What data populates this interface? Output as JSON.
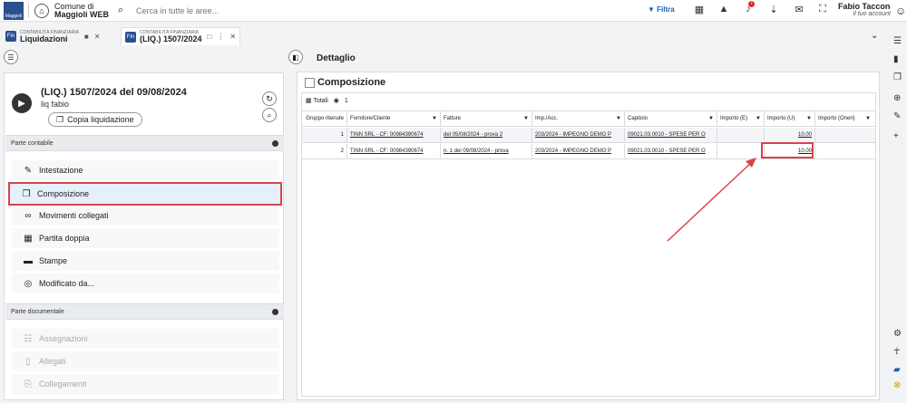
{
  "topbar": {
    "logo_text": "Maggioli",
    "org_line1": "Comune di",
    "org_line2": "Maggioli WEB",
    "search_placeholder": "Cerca in tutte le aree...",
    "filter_label": "Filtra",
    "notification_count": "7",
    "user_name": "Fabio Tacconeli...",
    "user_sub": "Il tuo account"
  },
  "tabs": [
    {
      "icon": "Fin",
      "small": "CONTABILITÀ FINANZIARIA",
      "label": "Liquidazioni"
    },
    {
      "icon": "Fin",
      "small": "CONTABILITÀ FINANZIARIA",
      "label": "(LIQ.) 1507/2024"
    }
  ],
  "left": {
    "title": "(LIQ.) 1507/2024 del 09/08/2024",
    "subtitle": "liq fabio",
    "copy_label": "Copia liquidazione",
    "section1": "Parte contabile",
    "items1": [
      {
        "label": "Intestazione"
      },
      {
        "label": "Composizione"
      },
      {
        "label": "Movimenti collegati"
      },
      {
        "label": "Partita doppia"
      },
      {
        "label": "Stampe"
      },
      {
        "label": "Modificato da..."
      }
    ],
    "section2": "Parte documentale",
    "items2": [
      {
        "label": "Assegnazioni"
      },
      {
        "label": "Allegati"
      },
      {
        "label": "Collegamenti"
      }
    ]
  },
  "detail": {
    "header": "Dettaglio",
    "title": "Composizione",
    "totals_label": "Totali",
    "toolbar_extra": "1",
    "columns": [
      "Gruppo ritenute",
      "Fornitore/Cliente",
      "Fatture",
      "Imp./Acc.",
      "Capitolo",
      "Importo (E)",
      "Importo (U)",
      "Importo (Oneri)"
    ],
    "rows": [
      [
        "1",
        "TINN SRL - CF: 00984390674",
        "del 05/08/2024 - prova 2",
        "203/2024 - IMPEGNO DEMO P",
        "09021.03.0010 - SPESE PER O",
        "",
        "10,00",
        ""
      ],
      [
        "2",
        "TINN SRL - CF: 00984390674",
        "n. 1 del 09/08/2024 - prova",
        "203/2024 - IMPEGNO DEMO P",
        "09021.03.0010 - SPESE PER O",
        "",
        "10,00",
        ""
      ]
    ]
  }
}
